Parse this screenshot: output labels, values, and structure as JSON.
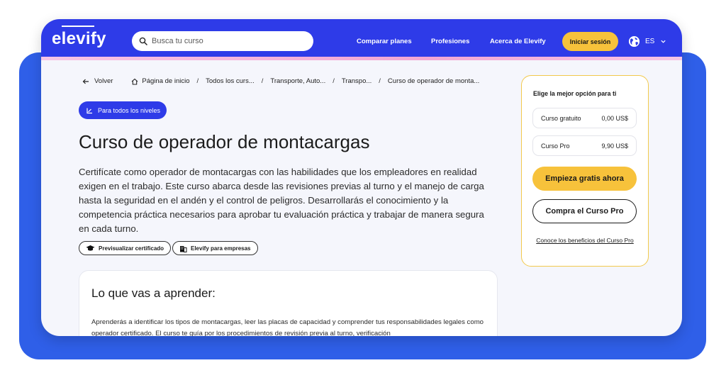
{
  "navbar": {
    "logo": "elevify",
    "search_placeholder": "Busca tu curso",
    "links": [
      "Comparar planes",
      "Profesiones",
      "Acerca de Elevify"
    ],
    "login_label": "Iniciar sesión",
    "language": "ES"
  },
  "breadcrumb": {
    "back": "Volver",
    "items": [
      "Página de inicio",
      "Todos los curs...",
      "Transporte, Auto...",
      "Transpo...",
      "Curso de operador de monta..."
    ]
  },
  "course": {
    "level": "Para todos los niveles",
    "title": "Curso de operador de montacargas",
    "description": "Certifícate como operador de montacargas con las habilidades que los empleadores en realidad exigen en el trabajo. Este curso abarca desde las revisiones previas al turno y el manejo de carga hasta la seguridad en el andén y el control de peligros. Desarrollarás el conocimiento y la competencia práctica necesarios para aprobar tu evaluación práctica y trabajar de manera segura en cada turno.",
    "chips": [
      "Previsualizar certificado",
      "Elevify para empresas"
    ]
  },
  "learn": {
    "heading": "Lo que vas a aprender:",
    "text": "Aprenderás a identificar los tipos de montacargas, leer las placas de capacidad y comprender tus responsabilidades legales como operador certificado. El curso te guía por los procedimientos de revisión previa al turno, verificación"
  },
  "pricing": {
    "heading": "Elige la mejor opción para ti",
    "plans": [
      {
        "name": "Curso gratuito",
        "price": "0,00 US$"
      },
      {
        "name": "Curso Pro",
        "price": "9,90 US$"
      }
    ],
    "start_label": "Empieza gratis ahora",
    "buy_label": "Compra el Curso Pro",
    "benefits_label": "Conoce los beneficios del Curso Pro"
  },
  "colors": {
    "primary": "#2e3be8",
    "accent": "#f7c23b",
    "frame": "#2f5fe8"
  }
}
